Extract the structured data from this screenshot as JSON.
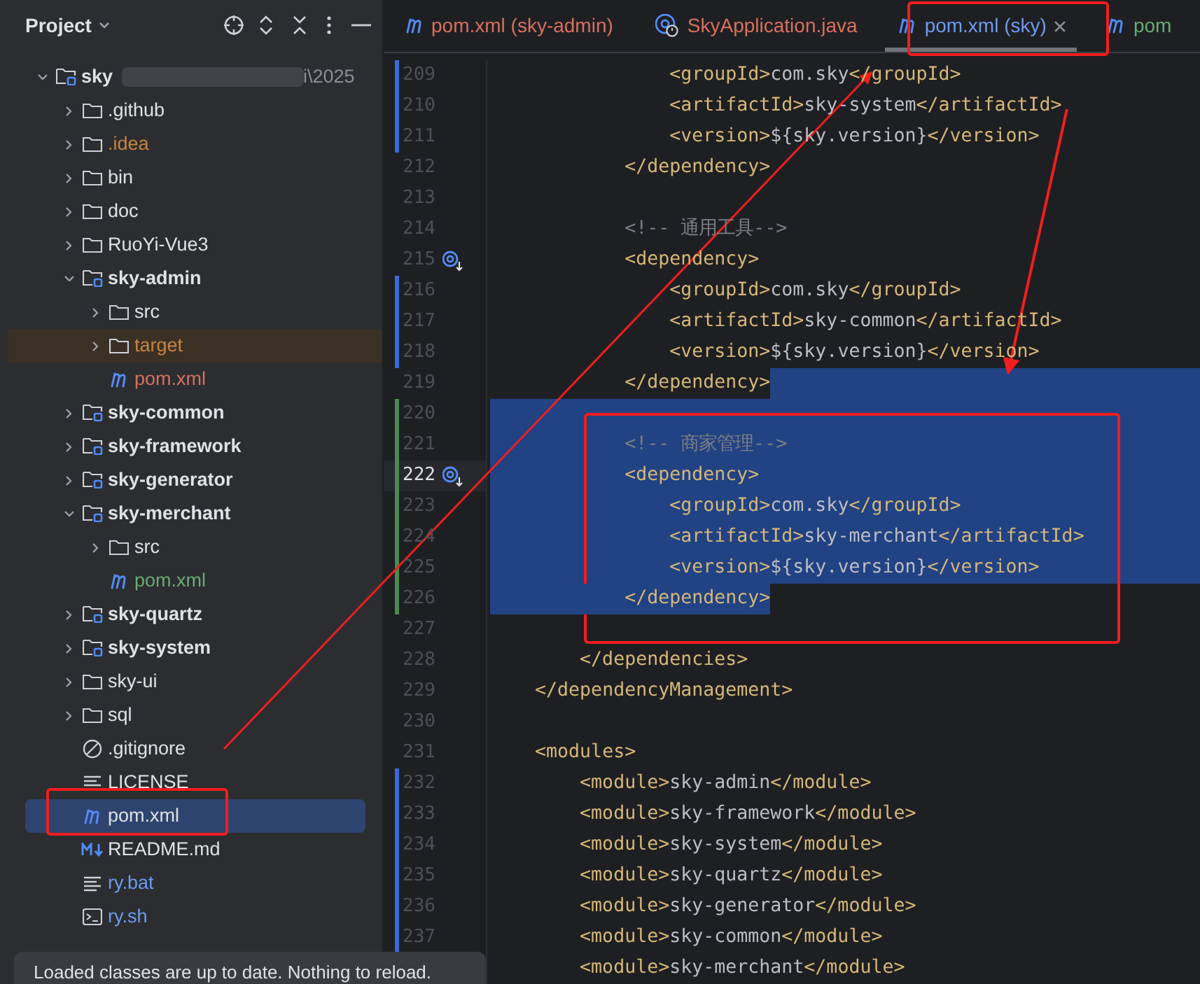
{
  "project_panel": {
    "title": "Project",
    "tree": [
      {
        "label": "sky",
        "kind": "module",
        "expanded": true,
        "selected": false,
        "redacted": true,
        "path": "i\\2025",
        "children": [
          {
            "label": ".github",
            "kind": "folder",
            "expanded": false,
            "selected": false
          },
          {
            "label": ".idea",
            "kind": "folder",
            "expanded": false,
            "selected": false,
            "color": "#c7843f"
          },
          {
            "label": "bin",
            "kind": "folder",
            "expanded": false,
            "selected": false
          },
          {
            "label": "doc",
            "kind": "folder",
            "expanded": false,
            "selected": false
          },
          {
            "label": "RuoYi-Vue3",
            "kind": "folder",
            "expanded": false,
            "selected": false
          },
          {
            "label": "sky-admin",
            "kind": "module",
            "expanded": true,
            "selected": false,
            "children": [
              {
                "label": "src",
                "kind": "folder",
                "expanded": false,
                "selected": false
              },
              {
                "label": "target",
                "kind": "folder",
                "expanded": false,
                "selected": false,
                "color": "#c7843f",
                "excluded": true
              },
              {
                "label": "pom.xml",
                "kind": "maven",
                "selected": false,
                "color": "#d8705f"
              }
            ]
          },
          {
            "label": "sky-common",
            "kind": "module",
            "expanded": false,
            "selected": false
          },
          {
            "label": "sky-framework",
            "kind": "module",
            "expanded": false,
            "selected": false
          },
          {
            "label": "sky-generator",
            "kind": "module",
            "expanded": false,
            "selected": false
          },
          {
            "label": "sky-merchant",
            "kind": "module",
            "expanded": true,
            "selected": false,
            "children": [
              {
                "label": "src",
                "kind": "folder",
                "expanded": false,
                "selected": false
              },
              {
                "label": "pom.xml",
                "kind": "maven",
                "selected": false,
                "color": "#6aab73"
              }
            ]
          },
          {
            "label": "sky-quartz",
            "kind": "module",
            "expanded": false,
            "selected": false
          },
          {
            "label": "sky-system",
            "kind": "module",
            "expanded": false,
            "selected": false
          },
          {
            "label": "sky-ui",
            "kind": "folder",
            "expanded": false,
            "selected": false
          },
          {
            "label": "sql",
            "kind": "folder",
            "expanded": false,
            "selected": false
          },
          {
            "label": ".gitignore",
            "kind": "ignore",
            "selected": false
          },
          {
            "label": "LICENSE",
            "kind": "text",
            "selected": false
          },
          {
            "label": "pom.xml",
            "kind": "maven",
            "selected": true
          },
          {
            "label": "README.md",
            "kind": "markdown",
            "selected": false
          },
          {
            "label": "ry.bat",
            "kind": "text",
            "selected": false,
            "color": "#6c9bf0"
          },
          {
            "label": "ry.sh",
            "kind": "shell",
            "selected": false,
            "color": "#6c9bf0"
          }
        ]
      }
    ]
  },
  "tabs": [
    {
      "label": "pom.xml (sky-admin)",
      "kind": "maven",
      "color": "#d8705f",
      "selected": false
    },
    {
      "label": "SkyApplication.java",
      "kind": "java",
      "color": "#d8705f",
      "selected": false
    },
    {
      "label": "pom.xml (sky)",
      "kind": "maven",
      "color": "#6c9bf0",
      "selected": true,
      "closable": true
    },
    {
      "label": "pom",
      "kind": "maven",
      "color": "#6aab73",
      "selected": false
    }
  ],
  "editor": {
    "lines": [
      {
        "number": "209",
        "kind": "code",
        "modified": true,
        "selected": false,
        "text": "                <groupId>com.sky</groupId>"
      },
      {
        "number": "210",
        "kind": "code",
        "modified": true,
        "selected": false,
        "text": "                <artifactId>sky-system</artifactId>"
      },
      {
        "number": "211",
        "kind": "code",
        "modified": true,
        "selected": false,
        "text": "                <version>${sky.version}</version>"
      },
      {
        "number": "212",
        "kind": "code",
        "selected": false,
        "text": "            </dependency>"
      },
      {
        "number": "213",
        "selected": false
      },
      {
        "number": "214",
        "kind": "comment",
        "selected": false,
        "text": "            <!-- 通用工具-->"
      },
      {
        "number": "215",
        "kind": "code",
        "selected": false,
        "gutter_icon": true,
        "text": "            <dependency>"
      },
      {
        "number": "216",
        "kind": "code",
        "modified": true,
        "selected": false,
        "text": "                <groupId>com.sky</groupId>"
      },
      {
        "number": "217",
        "kind": "code",
        "modified": true,
        "selected": false,
        "text": "                <artifactId>sky-common</artifactId>"
      },
      {
        "number": "218",
        "kind": "code",
        "modified": true,
        "selected": false,
        "text": "                <version>${sky.version}</version>"
      },
      {
        "number": "219",
        "kind": "code",
        "selected": false,
        "selected_after_text": true,
        "text": "            </dependency>"
      },
      {
        "number": "220",
        "added": true,
        "selected": true
      },
      {
        "number": "221",
        "kind": "comment",
        "added": true,
        "selected": true,
        "text": "            <!-- 商家管理-->"
      },
      {
        "number": "222",
        "kind": "code",
        "added": true,
        "selected": true,
        "current": true,
        "gutter_icon": true,
        "text": "            <dependency>"
      },
      {
        "number": "223",
        "kind": "code",
        "added": true,
        "selected": true,
        "text": "                <groupId>com.sky</groupId>"
      },
      {
        "number": "224",
        "kind": "code",
        "added": true,
        "selected": true,
        "text": "                <artifactId>sky-merchant</artifactId>"
      },
      {
        "number": "225",
        "kind": "code",
        "added": true,
        "selected": true,
        "text": "                <version>${sky.version}</version>"
      },
      {
        "number": "226",
        "kind": "code",
        "added": true,
        "selected": false,
        "selected_text": true,
        "text": "            </dependency>"
      },
      {
        "number": "227",
        "selected": false
      },
      {
        "number": "228",
        "kind": "code",
        "selected": false,
        "text": "        </dependencies>"
      },
      {
        "number": "229",
        "kind": "code",
        "selected": false,
        "text": "    </dependencyManagement>"
      },
      {
        "number": "230",
        "selected": false
      },
      {
        "number": "231",
        "kind": "code",
        "selected": false,
        "text": "    <modules>"
      },
      {
        "number": "232",
        "kind": "code",
        "modified": true,
        "selected": false,
        "text": "        <module>sky-admin</module>"
      },
      {
        "number": "233",
        "kind": "code",
        "modified": true,
        "selected": false,
        "text": "        <module>sky-framework</module>"
      },
      {
        "number": "234",
        "kind": "code",
        "modified": true,
        "selected": false,
        "text": "        <module>sky-system</module>"
      },
      {
        "number": "235",
        "kind": "code",
        "modified": true,
        "selected": false,
        "text": "        <module>sky-quartz</module>"
      },
      {
        "number": "236",
        "kind": "code",
        "modified": true,
        "selected": false,
        "text": "        <module>sky-generator</module>"
      },
      {
        "number": "237",
        "kind": "code",
        "modified": true,
        "selected": false,
        "text": "        <module>sky-common</module>"
      },
      {
        "kind": "code",
        "selected": false,
        "text": "        <module>sky-merchant</module>"
      }
    ]
  },
  "notification": {
    "text": "Loaded classes are up to date. Nothing to reload."
  }
}
